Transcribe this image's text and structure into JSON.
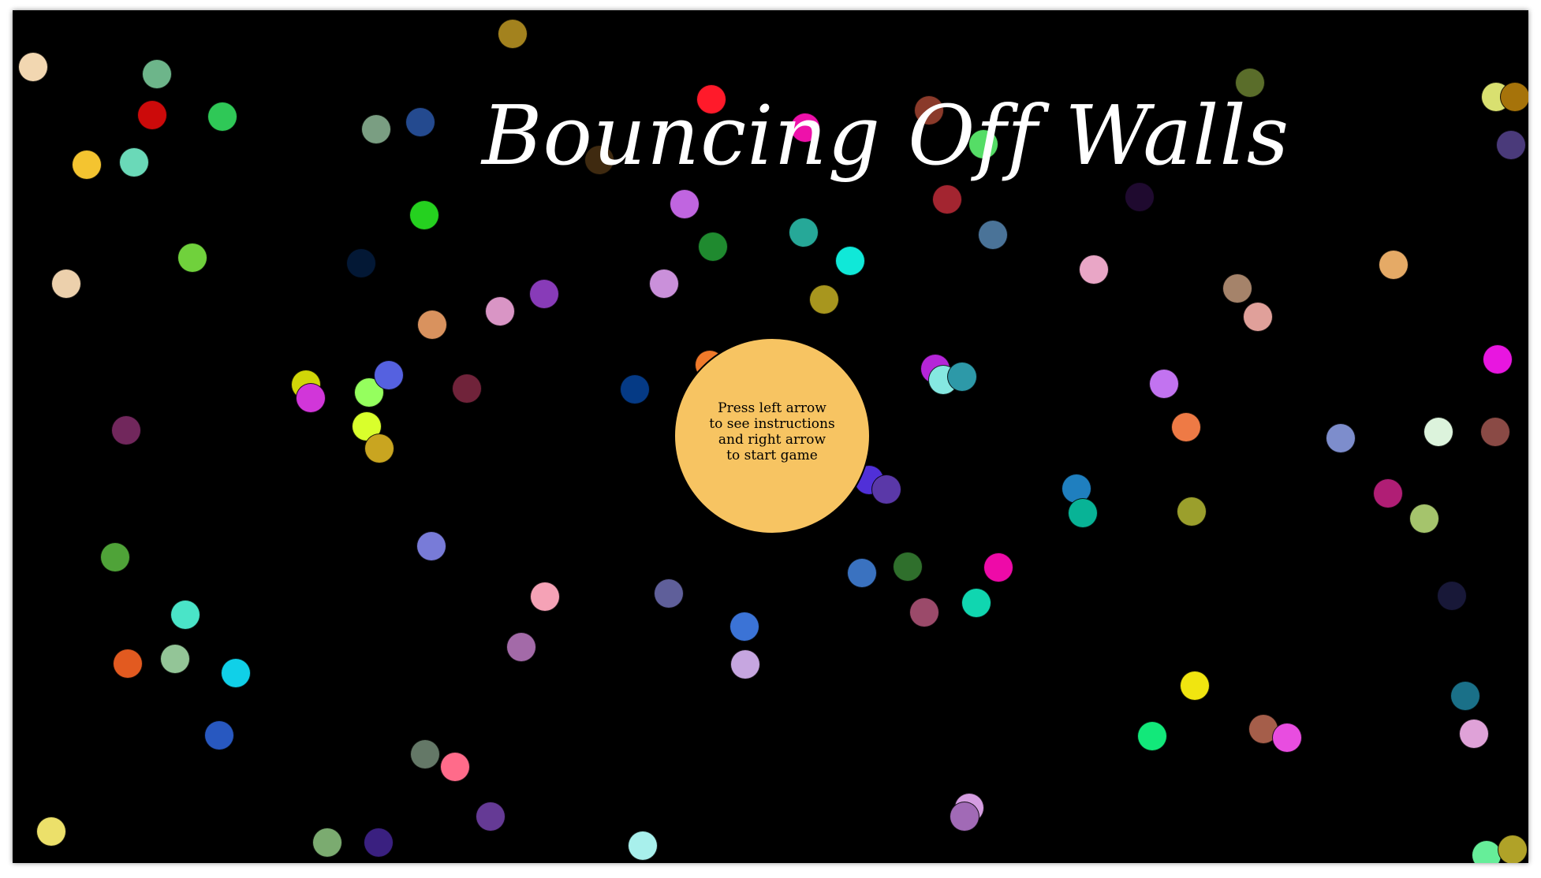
{
  "title": "Bouncing Off Walls",
  "prompt_lines": [
    "Press left arrow",
    "to see instructions",
    "and right arrow",
    "to start game"
  ],
  "colors": {
    "background": "#000000",
    "title": "#ffffff",
    "prompt_ball": "#f7c462",
    "balls": [
      "#a3821e",
      "#f2d7b1",
      "#6db58a",
      "#cc0a0a",
      "#2fc857",
      "#f4c430",
      "#6ad9b8",
      "#7a9e82",
      "#244a8f",
      "#ff1a2a",
      "#8a3a2a",
      "#ee11aa",
      "#55dd66",
      "#5a6d2a",
      "#d9e070",
      "#a6730a",
      "#4a3a7a",
      "#25d11f",
      "#c065e0",
      "#1f8a2f",
      "#26a898",
      "#10e8d8",
      "#a32530",
      "#4a7398",
      "#1f0a2f",
      "#e9a6c6",
      "#70d13c",
      "#ecd0ac",
      "#031835",
      "#d9925e",
      "#d995c5",
      "#883bb8",
      "#ca90da",
      "#a8961e",
      "#e5aa66",
      "#a5836a",
      "#e0a09a",
      "#e816e0",
      "#d1d608",
      "#d136d9",
      "#95ff5e",
      "#5561e0",
      "#d9ff2c",
      "#c9a520",
      "#70233a",
      "#053a85",
      "#f07a2a",
      "#b525d8",
      "#85e8e1",
      "#2d99a8",
      "#c273f0",
      "#ee7a45",
      "#7d8dcc",
      "#dcf3dc",
      "#8a4a45",
      "#71275c",
      "#1f7fbf",
      "#08b396",
      "#9b9f2c",
      "#b01e75",
      "#a5c46c",
      "#5030d8",
      "#5a38a8",
      "#4fa338",
      "#787bd8",
      "#3a72c0",
      "#2f6f2c",
      "#ee0aa8",
      "#9b4a6a",
      "#10d6b0",
      "#4ae4c8",
      "#e25a20",
      "#93c597",
      "#10d0e8",
      "#f5a2b6",
      "#5f5f9a",
      "#a36aa8",
      "#3b73d6",
      "#c6a6e0",
      "#181838",
      "#2858c0",
      "#f0e510",
      "#a55e4a",
      "#e84de0",
      "#12e87a",
      "#1a7088",
      "#dfa2d8",
      "#d59de1",
      "#647867",
      "#ff6b8a",
      "#653a95",
      "#ece06a",
      "#7bab70",
      "#3a2080",
      "#a8f0ec",
      "#a16ab6",
      "#66ee99",
      "#b0a228",
      "#3f2a10"
    ]
  }
}
